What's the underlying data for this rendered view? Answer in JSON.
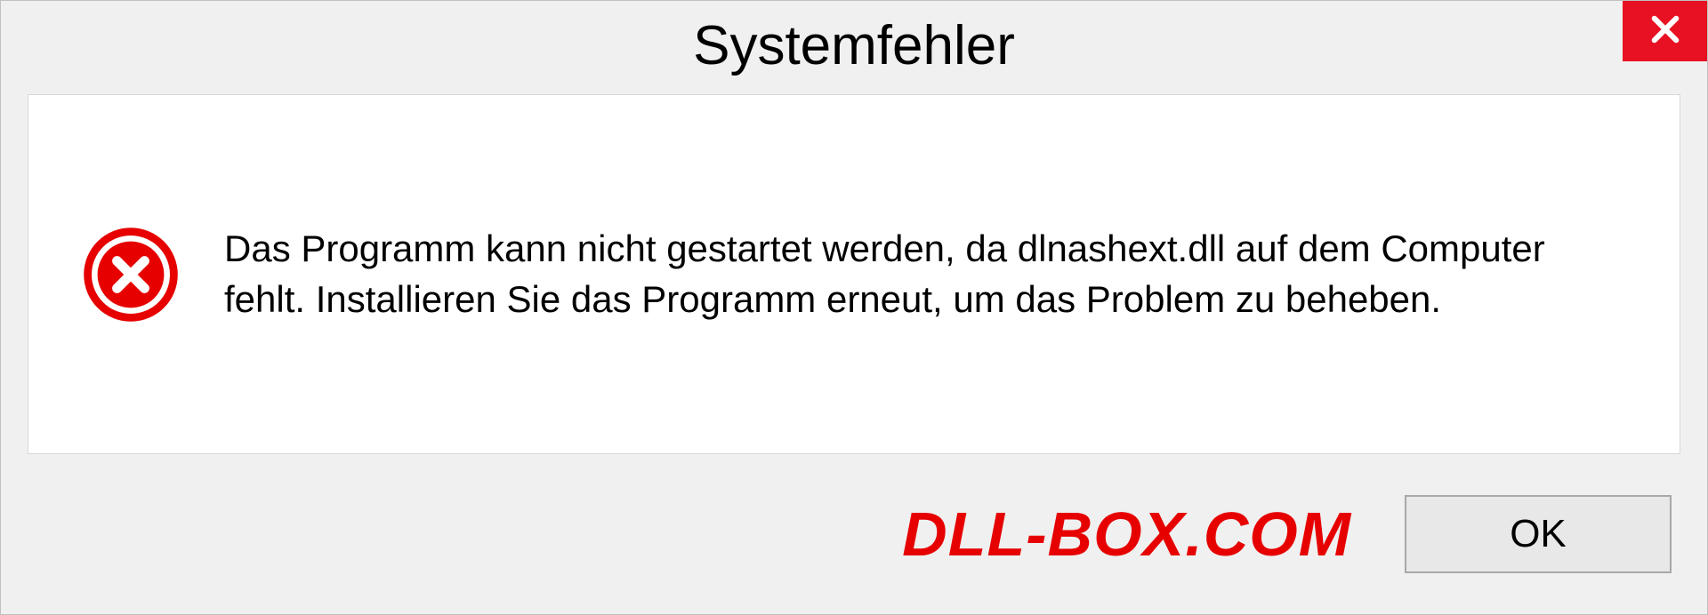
{
  "dialog": {
    "title": "Systemfehler",
    "message": "Das Programm kann nicht gestartet werden, da dlnashext.dll auf dem Computer fehlt. Installieren Sie das Programm erneut, um das Problem zu beheben.",
    "ok_label": "OK"
  },
  "watermark": "DLL-BOX.COM"
}
